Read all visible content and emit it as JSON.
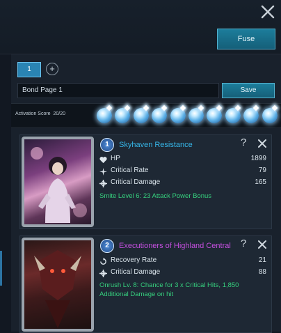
{
  "header": {
    "fuse_label": "Fuse"
  },
  "tabs": [
    {
      "label": "1"
    }
  ],
  "add_tab_symbol": "+",
  "bond_page": {
    "name_value": "Bond Page 1",
    "save_label": "Save"
  },
  "activation": {
    "label": "Activation Score",
    "score": "20/20",
    "orbs_filled": 10,
    "orbs_total": 10
  },
  "cards": [
    {
      "badge": "1",
      "title": "Skyhaven Resistance",
      "title_color": "#36b6e8",
      "help_symbol": "?",
      "stats": [
        {
          "icon": "heart-icon",
          "label": "HP",
          "value": "1899"
        },
        {
          "icon": "spark-icon",
          "label": "Critical Rate",
          "value": "79"
        },
        {
          "icon": "crosshair-icon",
          "label": "Critical Damage",
          "value": "165"
        }
      ],
      "bonus": "Smite Level 6: 23 Attack Power Bonus"
    },
    {
      "badge": "2",
      "title": "Executioners of Highland Central",
      "title_color": "#c64fe0",
      "help_symbol": "?",
      "stats": [
        {
          "icon": "recovery-icon",
          "label": "Recovery Rate",
          "value": "21"
        },
        {
          "icon": "crosshair-icon",
          "label": "Critical Damage",
          "value": "88"
        }
      ],
      "bonus": "Onrush Lv. 8: Chance for 3 x Critical Hits, 1,850 Additional Damage on hit"
    }
  ],
  "colors": {
    "accent": "#1c7d9b",
    "bonus_text": "#36d07e"
  }
}
